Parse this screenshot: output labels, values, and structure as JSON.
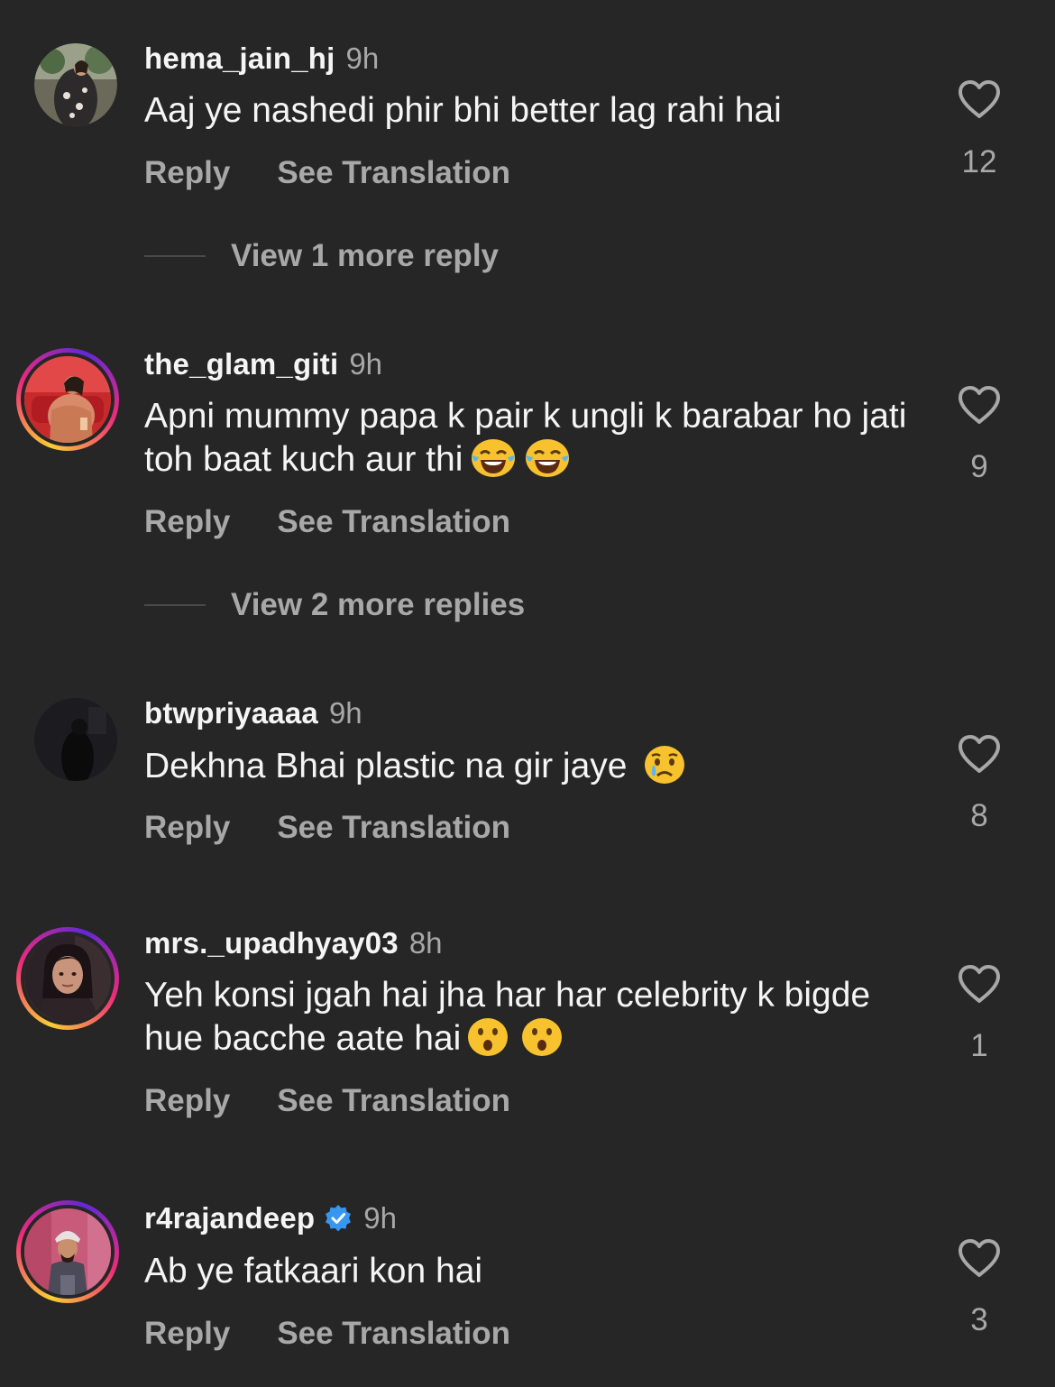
{
  "actions": {
    "reply": "Reply",
    "translate": "See Translation"
  },
  "comments": [
    {
      "username": "hema_jain_hj",
      "time": "9h",
      "verified": false,
      "story_ring": false,
      "avatar": "person-in-floral-dress-avatar",
      "text": "Aaj ye nashedi phir bhi better lag rahi hai",
      "emojis": [],
      "likes": "12",
      "more_replies": "View 1 more reply"
    },
    {
      "username": "the_glam_giti",
      "time": "9h",
      "verified": false,
      "story_ring": true,
      "avatar": "person-in-red-room-avatar",
      "text": "Apni mummy papa k pair k ungli k barabar ho jati toh baat kuch aur thi",
      "emojis": [
        "face-with-tears-of-joy-icon",
        "face-with-tears-of-joy-icon"
      ],
      "likes": "9",
      "more_replies": "View 2 more replies"
    },
    {
      "username": "btwpriyaaaa",
      "time": "9h",
      "verified": false,
      "story_ring": false,
      "avatar": "dark-silhouette-avatar",
      "text": "Dekhna Bhai plastic na gir jaye",
      "emojis": [
        "crying-face-icon"
      ],
      "likes": "8",
      "more_replies": ""
    },
    {
      "username": "mrs._upadhyay03",
      "time": "8h",
      "verified": false,
      "story_ring": true,
      "avatar": "woman-selfie-avatar",
      "text": "Yeh konsi jgah hai jha har har celebrity k bigde hue bacche aate hai",
      "emojis": [
        "hushed-face-icon",
        "hushed-face-icon"
      ],
      "likes": "1",
      "more_replies": ""
    },
    {
      "username": "r4rajandeep",
      "time": "9h",
      "verified": true,
      "story_ring": true,
      "avatar": "man-with-turban-avatar",
      "text": "Ab ye fatkaari kon hai",
      "emojis": [],
      "likes": "3",
      "more_replies": ""
    }
  ],
  "colors": {
    "background": "#262626",
    "primary_text": "#f5f5f5",
    "secondary_text": "#a8a8a8",
    "verified_badge": "#3797f0",
    "story_ring": [
      "#f9ce34",
      "#ee2a7b",
      "#6228d7"
    ]
  }
}
